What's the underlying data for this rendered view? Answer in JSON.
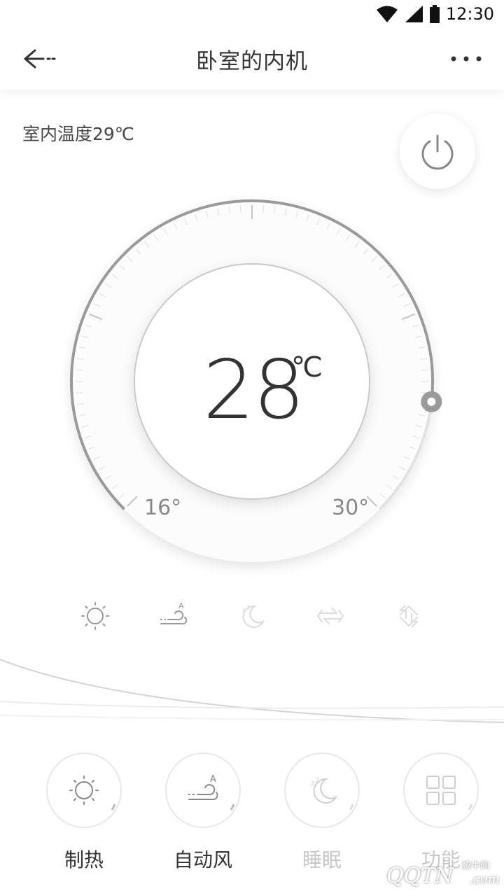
{
  "status_bar": {
    "time": "12:30"
  },
  "header": {
    "title": "卧室的内机"
  },
  "indoor_temperature": "室内温度29℃",
  "thermostat": {
    "set_temperature": "28",
    "unit": "℃",
    "min_label": "16°",
    "max_label": "30°",
    "range": {
      "min": 16,
      "max": 30,
      "value": 28
    }
  },
  "mode_icons": [
    "sun-icon",
    "auto-wind-icon",
    "sleep-moon-icon",
    "swing-horizontal-icon",
    "swing-vertical-icon"
  ],
  "controls": [
    {
      "label": "制热",
      "icon": "sun-icon",
      "enabled": true
    },
    {
      "label": "自动风",
      "icon": "auto-wind-icon",
      "enabled": true
    },
    {
      "label": "睡眠",
      "icon": "sleep-moon-icon",
      "enabled": false
    },
    {
      "label": "功能",
      "icon": "grid-icon",
      "enabled": false
    }
  ],
  "watermark": {
    "brand": "QQTN",
    "subtext": "腾牛网",
    "suffix": ".com"
  },
  "colors": {
    "accent": "#999999",
    "text": "#333333",
    "dim": "#c8c8c8"
  }
}
